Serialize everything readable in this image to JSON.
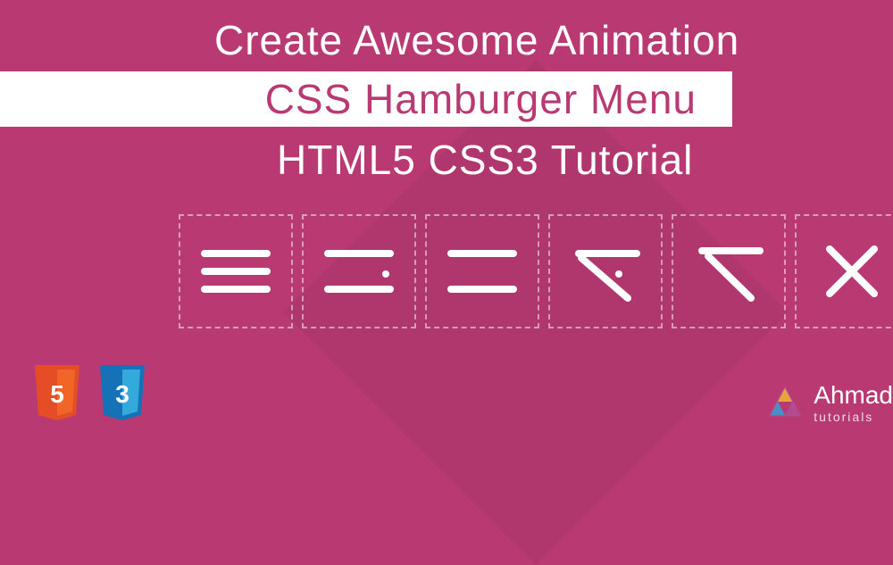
{
  "title": {
    "line1": "Create Awesome Animation",
    "line2": "CSS Hamburger Menu",
    "line3": "HTML5 CSS3 Tutorial"
  },
  "tech": {
    "html5_label": "5",
    "css3_label": "3"
  },
  "brand": {
    "name": "Ahmad",
    "sub": "tutorials"
  },
  "colors": {
    "bg": "#b93a73",
    "html5": "#e44d26",
    "css3": "#1572b6"
  }
}
